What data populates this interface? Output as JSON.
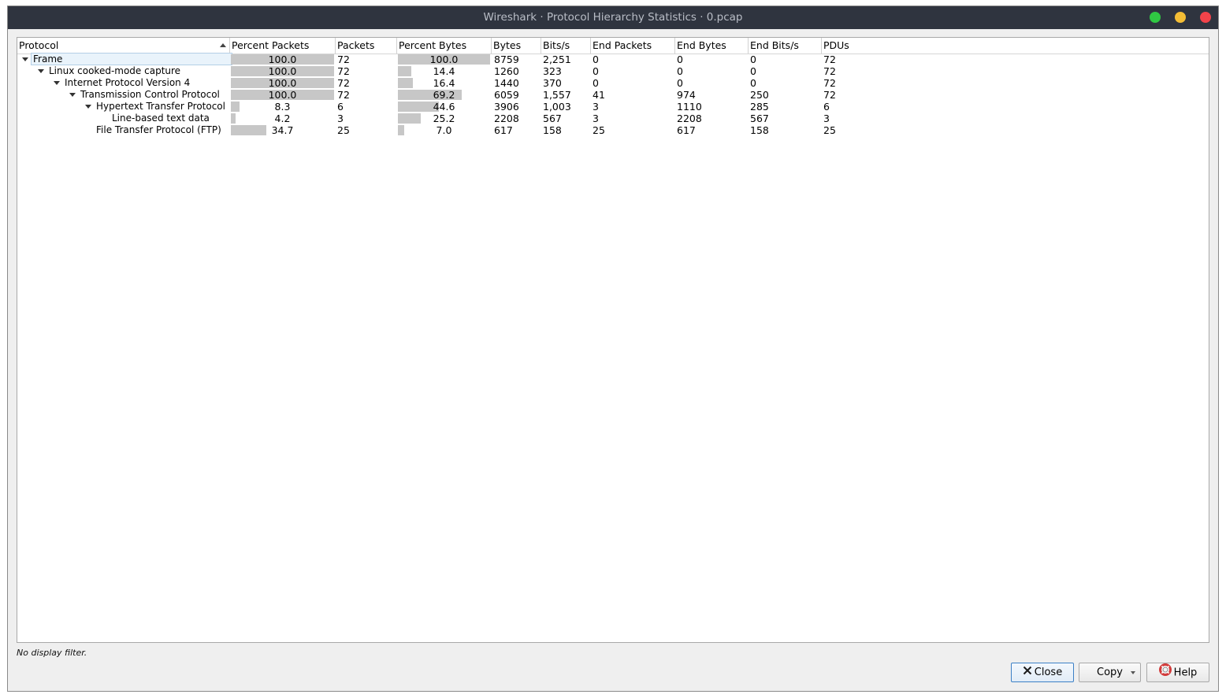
{
  "window": {
    "title": "Wireshark · Protocol Hierarchy Statistics · 0.pcap"
  },
  "columns": {
    "protocol": "Protocol",
    "percent_packets": "Percent Packets",
    "packets": "Packets",
    "percent_bytes": "Percent Bytes",
    "bytes": "Bytes",
    "bits_per_s": "Bits/s",
    "end_packets": "End Packets",
    "end_bytes": "End Bytes",
    "end_bits_per_s": "End Bits/s",
    "pdus": "PDUs"
  },
  "rows": [
    {
      "protocol": "Frame",
      "depth": 0,
      "expanded": true,
      "selected": true,
      "percent_packets": "100.0",
      "packets": "72",
      "percent_bytes": "100.0",
      "bytes": "8759",
      "bits_per_s": "2,251",
      "end_packets": "0",
      "end_bytes": "0",
      "end_bits_per_s": "0",
      "pdus": "72",
      "pp_fill": 1.0,
      "pb_fill": 1.0
    },
    {
      "protocol": "Linux cooked-mode capture",
      "depth": 1,
      "expanded": true,
      "selected": false,
      "percent_packets": "100.0",
      "packets": "72",
      "percent_bytes": "14.4",
      "bytes": "1260",
      "bits_per_s": "323",
      "end_packets": "0",
      "end_bytes": "0",
      "end_bits_per_s": "0",
      "pdus": "72",
      "pp_fill": 1.0,
      "pb_fill": 0.144
    },
    {
      "protocol": "Internet Protocol Version 4",
      "depth": 2,
      "expanded": true,
      "selected": false,
      "percent_packets": "100.0",
      "packets": "72",
      "percent_bytes": "16.4",
      "bytes": "1440",
      "bits_per_s": "370",
      "end_packets": "0",
      "end_bytes": "0",
      "end_bits_per_s": "0",
      "pdus": "72",
      "pp_fill": 1.0,
      "pb_fill": 0.164
    },
    {
      "protocol": "Transmission Control Protocol",
      "depth": 3,
      "expanded": true,
      "selected": false,
      "percent_packets": "100.0",
      "packets": "72",
      "percent_bytes": "69.2",
      "bytes": "6059",
      "bits_per_s": "1,557",
      "end_packets": "41",
      "end_bytes": "974",
      "end_bits_per_s": "250",
      "pdus": "72",
      "pp_fill": 1.0,
      "pb_fill": 0.692
    },
    {
      "protocol": "Hypertext Transfer Protocol",
      "depth": 4,
      "expanded": true,
      "selected": false,
      "percent_packets": "8.3",
      "packets": "6",
      "percent_bytes": "44.6",
      "bytes": "3906",
      "bits_per_s": "1,003",
      "end_packets": "3",
      "end_bytes": "1110",
      "end_bits_per_s": "285",
      "pdus": "6",
      "pp_fill": 0.083,
      "pb_fill": 0.446
    },
    {
      "protocol": "Line-based text data",
      "depth": 5,
      "expanded": null,
      "selected": false,
      "percent_packets": "4.2",
      "packets": "3",
      "percent_bytes": "25.2",
      "bytes": "2208",
      "bits_per_s": "567",
      "end_packets": "3",
      "end_bytes": "2208",
      "end_bits_per_s": "567",
      "pdus": "3",
      "pp_fill": 0.042,
      "pb_fill": 0.252
    },
    {
      "protocol": "File Transfer Protocol (FTP)",
      "depth": 4,
      "expanded": null,
      "selected": false,
      "percent_packets": "34.7",
      "packets": "25",
      "percent_bytes": "7.0",
      "bytes": "617",
      "bits_per_s": "158",
      "end_packets": "25",
      "end_bytes": "617",
      "end_bits_per_s": "158",
      "pdus": "25",
      "pp_fill": 0.347,
      "pb_fill": 0.07
    }
  ],
  "status": {
    "filter_text": "No display filter."
  },
  "buttons": {
    "close_label": "Close",
    "copy_label": "Copy",
    "help_label": "Help"
  },
  "colors": {
    "titlebar": "#2f343f",
    "bar_fill": "#c7c7c7",
    "btn_max": "#30c843",
    "btn_min": "#f4bd35",
    "btn_close": "#f2434a"
  }
}
